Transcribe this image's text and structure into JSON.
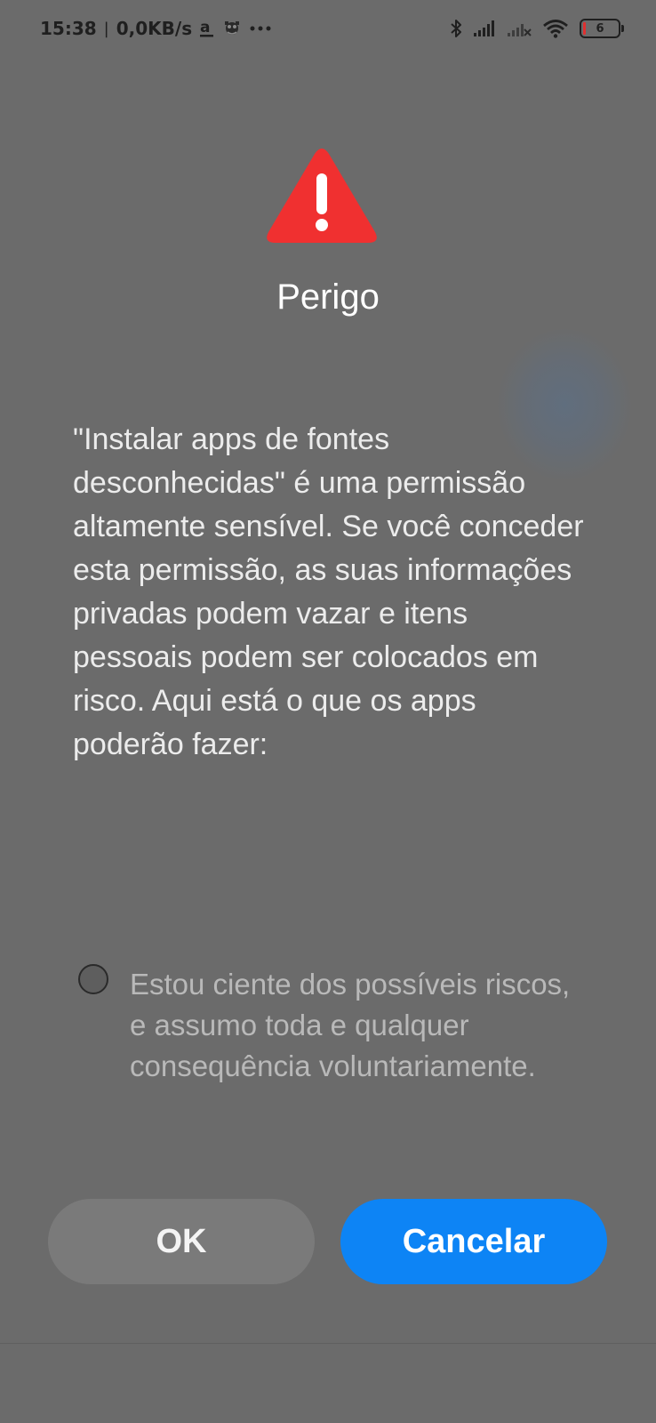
{
  "status_bar": {
    "time": "15:38",
    "separator": "|",
    "net_speed": "0,0KB/s",
    "notification_icons": [
      "amazon-icon",
      "app-icon",
      "more-icon"
    ],
    "right_icons": [
      "bluetooth-icon",
      "signal-icon",
      "signal-nosim-icon",
      "wifi-icon"
    ],
    "battery_level": "6",
    "battery_color": "#e03030"
  },
  "dialog": {
    "icon": "warning-icon",
    "icon_color": "#f03030",
    "title": "Perigo",
    "message": "\"Instalar apps de fontes desconhecidas\" é uma permissão altamente sensível. Se você conceder esta permissão, as suas informações privadas podem vazar e itens pessoais podem ser colocados em risco. Aqui está o que os apps poderão fazer:",
    "consent": {
      "label": "Estou ciente dos possíveis riscos, e assumo toda e qualquer consequência voluntariamente.",
      "checked": false
    },
    "buttons": {
      "ok_label": "OK",
      "cancel_label": "Cancelar"
    },
    "accent_color": "#0d84f5"
  }
}
